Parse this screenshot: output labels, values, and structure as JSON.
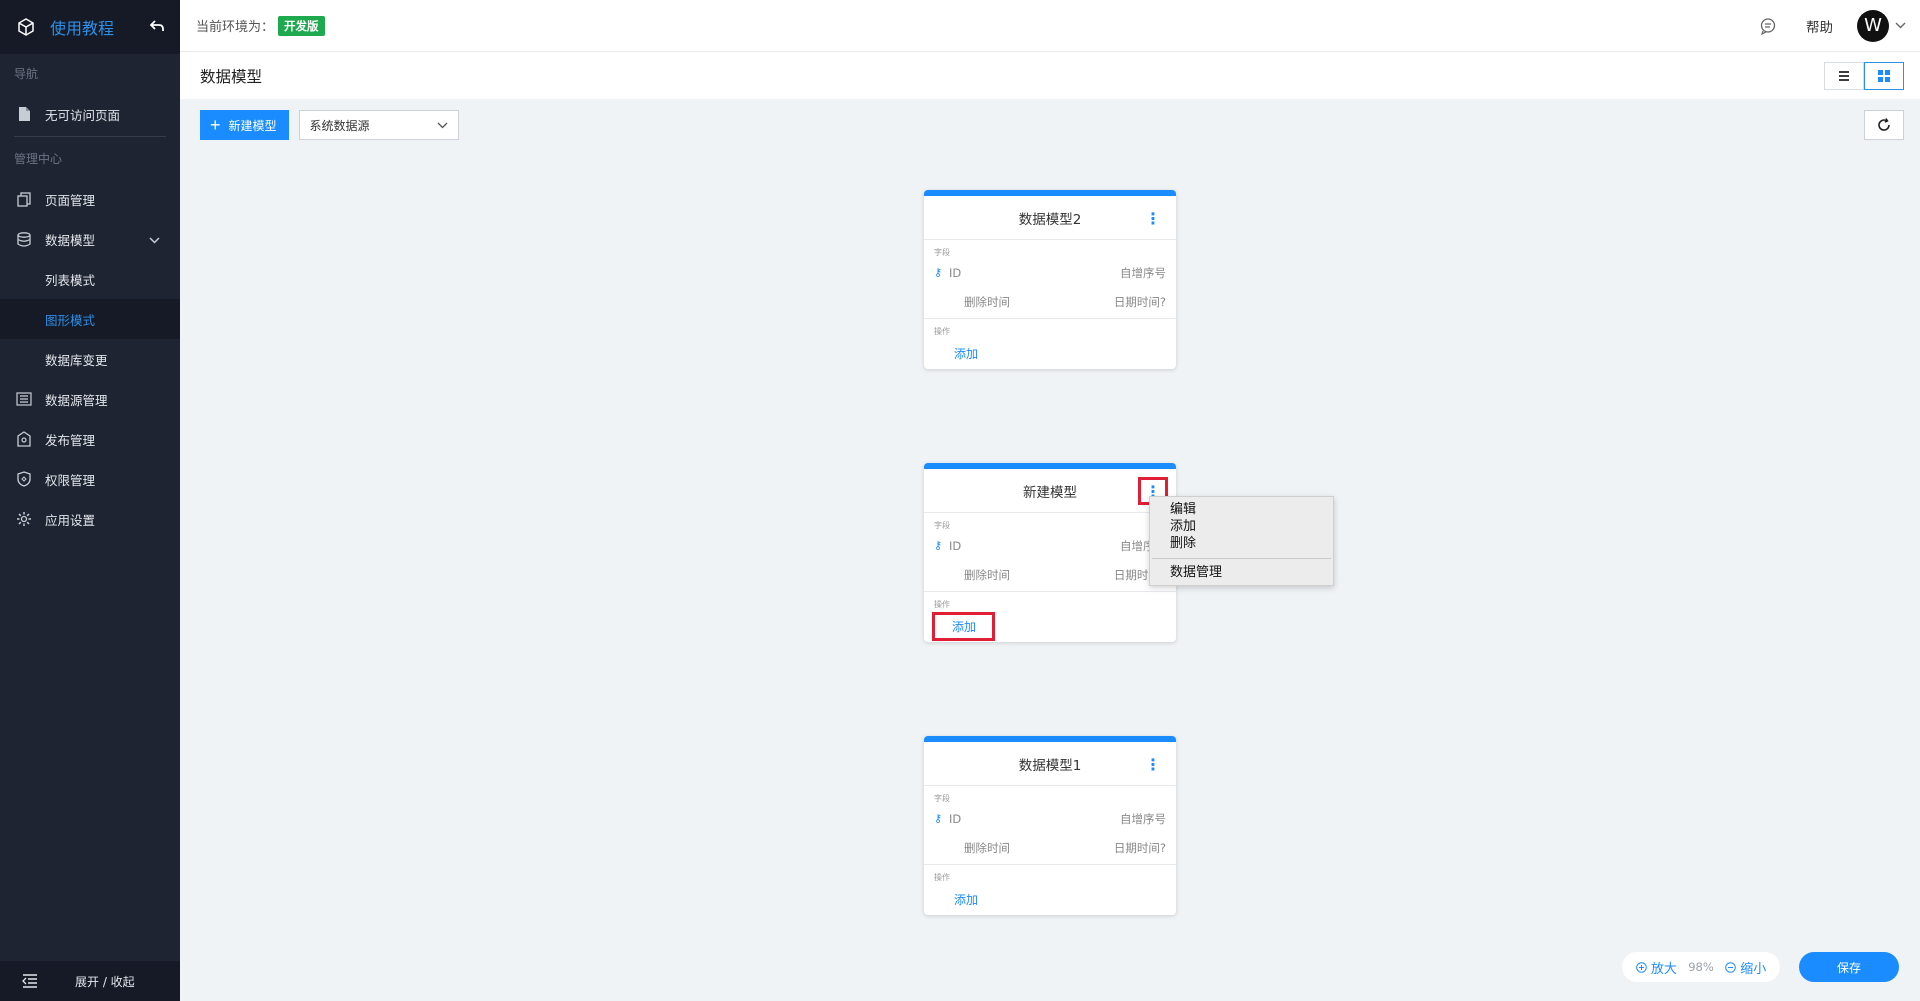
{
  "sidebar": {
    "brand": "使用教程",
    "section_nav": "导航",
    "nav_items": [
      {
        "label": "无可访问页面"
      }
    ],
    "section_admin": "管理中心",
    "items": [
      {
        "label": "页面管理"
      },
      {
        "label": "数据模型"
      },
      {
        "label": "数据源管理"
      },
      {
        "label": "发布管理"
      },
      {
        "label": "权限管理"
      },
      {
        "label": "应用设置"
      }
    ],
    "data_model_sub": [
      {
        "label": "列表模式",
        "active": false
      },
      {
        "label": "图形模式",
        "active": true
      },
      {
        "label": "数据库变更",
        "active": false
      }
    ],
    "footer_label": "展开 / 收起"
  },
  "topbar": {
    "env_label": "当前环境为：",
    "env_badge": "开发版",
    "help": "帮助",
    "avatar_letter": "W"
  },
  "header": {
    "title": "数据模型"
  },
  "toolbar": {
    "new_model": "新建模型",
    "datasource": "系统数据源"
  },
  "cards": [
    {
      "title": "数据模型2",
      "field_section": "字段",
      "fields": [
        {
          "name": "ID",
          "type": "自增序号",
          "primary": true
        },
        {
          "name": "删除时间",
          "type": "日期时间?",
          "primary": false
        }
      ],
      "action_section": "操作",
      "action": "添加"
    },
    {
      "title": "新建模型",
      "field_section": "字段",
      "fields": [
        {
          "name": "ID",
          "type": "自增序号",
          "primary": true
        },
        {
          "name": "删除时间",
          "type": "日期时间?",
          "primary": false
        }
      ],
      "action_section": "操作",
      "action": "添加"
    },
    {
      "title": "数据模型1",
      "field_section": "字段",
      "fields": [
        {
          "name": "ID",
          "type": "自增序号",
          "primary": true
        },
        {
          "name": "删除时间",
          "type": "日期时间?",
          "primary": false
        }
      ],
      "action_section": "操作",
      "action": "添加"
    }
  ],
  "context_menu": {
    "items": [
      "编辑",
      "添加",
      "删除"
    ],
    "extra": "数据管理"
  },
  "zoom": {
    "zoom_in": "放大",
    "percent": "98%",
    "zoom_out": "缩小"
  },
  "save": "保存",
  "colors": {
    "accent": "#1a8cff",
    "sidebar_bg": "#1e2431",
    "env_badge": "#1fa94f",
    "highlight": "#e01e36"
  }
}
